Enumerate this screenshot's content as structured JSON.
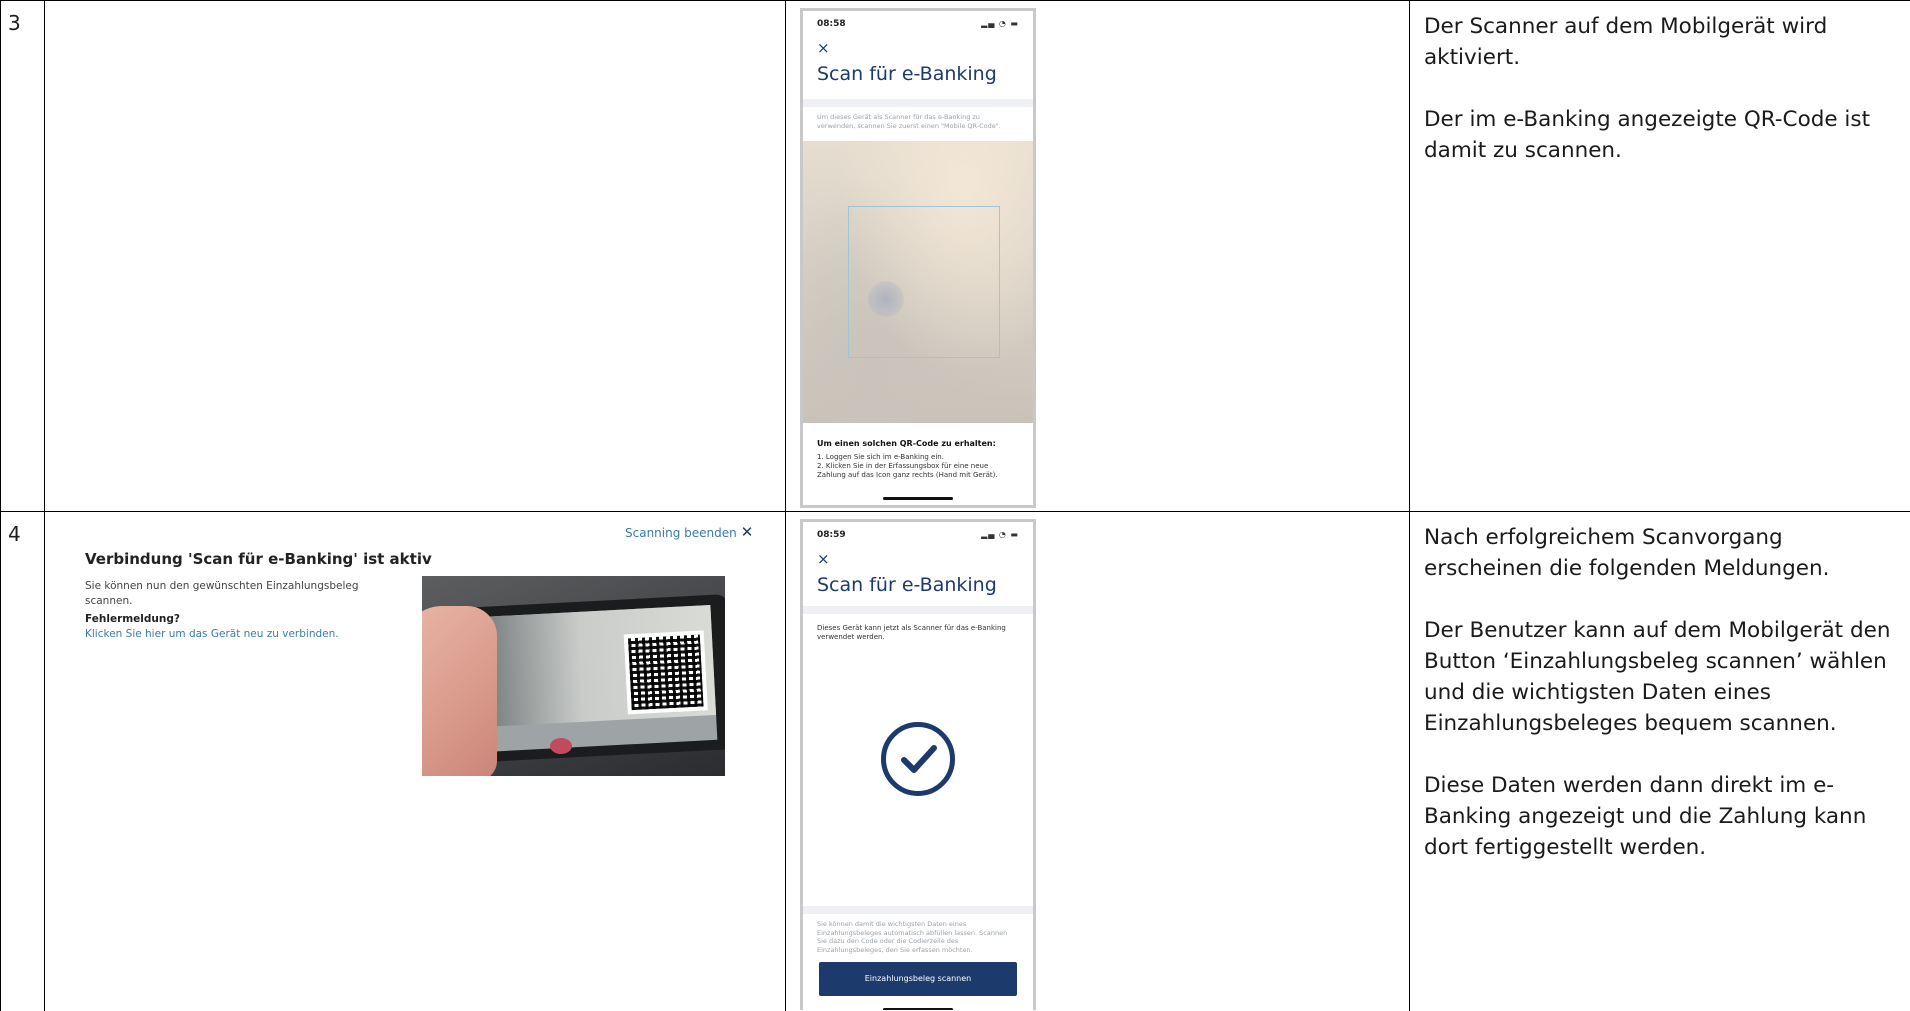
{
  "rows": [
    {
      "number": "3",
      "description": [
        "Der Scanner auf dem Mobilgerät wird aktiviert.",
        "Der im e-Banking angezeigte QR-Code ist damit zu scannen."
      ],
      "phone": {
        "time": "08:58",
        "status_icons": "signal wifi battery",
        "close": "×",
        "title": "Scan für e-Banking",
        "intro": "Um dieses Gerät als Scanner für das e-Banking zu verwenden, scannen Sie zuerst einen \"Mobile QR-Code\".",
        "info_title": "Um einen solchen QR-Code zu erhalten:",
        "info_steps": [
          "1. Loggen Sie sich im e-Banking ein.",
          "2. Klicken Sie in der Erfassungsbox für eine neue Zahlung auf das Icon ganz rechts (Hand mit Gerät)."
        ]
      }
    },
    {
      "number": "4",
      "description": [
        "Nach erfolgreichem Scanvorgang erscheinen die folgenden Meldungen.",
        "Der Benutzer kann auf dem Mobilgerät den Button ‘Einzahlungsbeleg scannen’ wählen und die wichtigsten Daten eines Einzahlungsbeleges bequem scannen.",
        "Diese Daten werden dann direkt im e-Banking angezeigt und die Zahlung kann dort fertiggestellt werden."
      ],
      "desktop": {
        "stop_link": "Scanning beenden",
        "title": "Verbindung 'Scan für e-Banking' ist aktiv",
        "text": "Sie können nun den gewünschten Einzahlungsbeleg scannen.",
        "error_label": "Fehlermeldung?",
        "error_link": "Klicken Sie hier um das Gerät neu zu verbinden."
      },
      "phone": {
        "time": "08:59",
        "close": "×",
        "title": "Scan für e-Banking",
        "intro": "Dieses Gerät kann jetzt als Scanner für das e-Banking verwendet werden.",
        "footer": "Sie können damit die wichtigsten Daten eines Einzahlungsbeleges automatisch abfüllen lassen. Scannen Sie dazu den Code oder die Codierzeile des Einzahlungsbeleges, den Sie erfassen möchten.",
        "button": "Einzahlungsbeleg scannen"
      }
    }
  ],
  "colors": {
    "brand_blue": "#1c3a6b",
    "link_blue": "#3a7ca5"
  }
}
